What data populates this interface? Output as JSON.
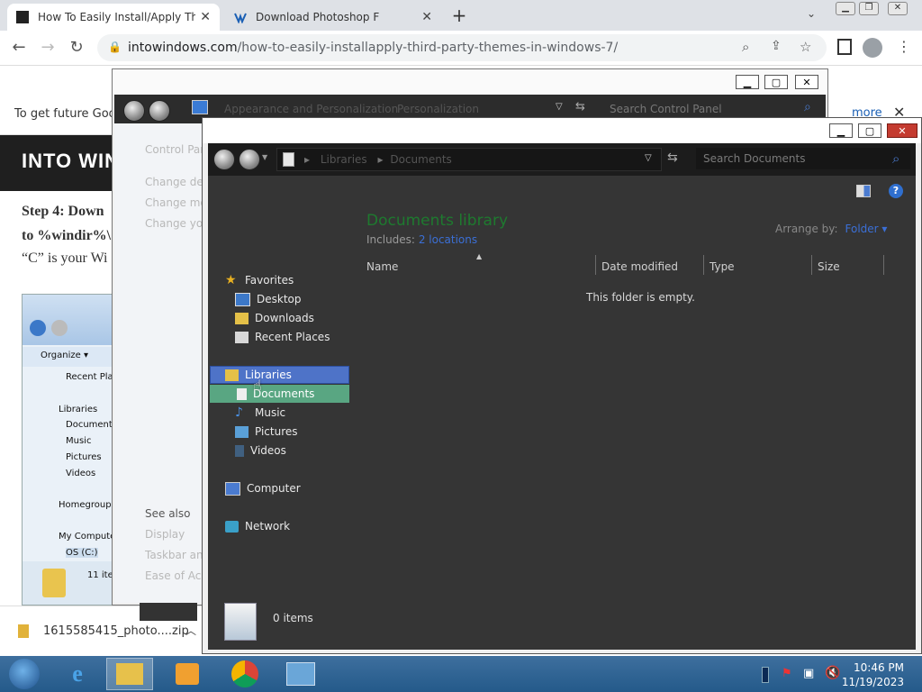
{
  "browser": {
    "tabs": [
      {
        "title": "How To Easily Install/Apply Third",
        "close": "✕"
      },
      {
        "title": "Download Photoshop F",
        "close": "✕"
      }
    ],
    "new_tab": "+",
    "url_host": "intowindows.com",
    "url_path": "/how-to-easily-installapply-third-party-themes-in-windows-7/",
    "infobar_text": "To get future Goog",
    "infobar_more": "more"
  },
  "page": {
    "logo": "INTO WIN",
    "step_lines": [
      "Step 4: Down",
      "to %windir%\\",
      "“C” is your Wi"
    ],
    "screenshot": {
      "organize": "Organize ▾",
      "items": [
        "Recent Plac",
        "Libraries",
        "Documents",
        "Music",
        "Pictures",
        "Videos",
        "Homegroup",
        "My Compute",
        "OS (C:)"
      ],
      "count": "11 ite"
    }
  },
  "download": {
    "filename": "1615585415_photo....zip"
  },
  "control_panel": {
    "breadcrumb": [
      "Appearance and Personalization",
      "Personalization"
    ],
    "search_placeholder": "Search Control Panel",
    "side_links": [
      "Control Pane",
      "Change desk",
      "Change mou",
      "Change you"
    ],
    "see_also": "See also",
    "see_also_links": [
      "Display",
      "Taskbar and",
      "Ease of Acce"
    ]
  },
  "explorer": {
    "breadcrumb": [
      "Libraries",
      "Documents"
    ],
    "search_placeholder": "Search Documents",
    "nav": {
      "favorites": "Favorites",
      "favorites_items": [
        "Desktop",
        "Downloads",
        "Recent Places"
      ],
      "libraries": "Libraries",
      "libraries_items": [
        "Documents",
        "Music",
        "Pictures",
        "Videos"
      ],
      "computer": "Computer",
      "network": "Network"
    },
    "library_title": "Documents library",
    "includes_label": "Includes:",
    "includes_link": "2 locations",
    "arrange_label": "Arrange by:",
    "arrange_value": "Folder ▾",
    "columns": [
      "Name",
      "Date modified",
      "Type",
      "Size"
    ],
    "empty_message": "This folder is empty.",
    "item_count": "0 items"
  },
  "taskbar": {
    "time": "10:46 PM",
    "date": "11/19/2023"
  },
  "colors": {
    "selection_libraries": "#4e73c8",
    "hover_documents": "#59a682",
    "library_title": "#1e7a2f",
    "link": "#3b6fd6"
  }
}
